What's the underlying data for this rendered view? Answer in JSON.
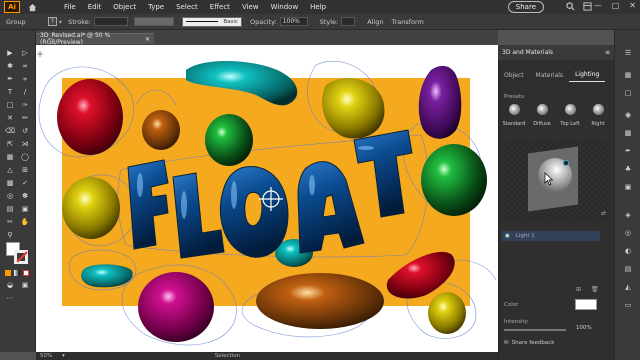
{
  "menubar": {
    "app_logo": "Ai",
    "items": [
      "File",
      "Edit",
      "Object",
      "Type",
      "Select",
      "Effect",
      "View",
      "Window",
      "Help"
    ],
    "share_label": "Share"
  },
  "controlbar": {
    "selection_label": "Group",
    "stroke_label": "Stroke:",
    "brush_label": "Basic",
    "opacity_label": "Opacity:",
    "opacity_value": "100%",
    "style_label": "Style:",
    "align_label": "Align",
    "transform_label": "Transform"
  },
  "document": {
    "tab_title": "3D_Revised.ai* @ 50 % (RGB/Preview)",
    "artwork_text": "FLOAT",
    "background_color": "#f5a91e"
  },
  "statusbar": {
    "zoom": "50%",
    "tool_name": "Selection"
  },
  "panel": {
    "title": "3D and Materials",
    "tabs": [
      "Object",
      "Materials",
      "Lighting"
    ],
    "active_tab": "Lighting",
    "presets_label": "Presets",
    "presets": [
      "Standard",
      "Diffuse",
      "Top Left",
      "Right"
    ],
    "light_name": "Light 1",
    "color_label": "Color",
    "intensity_label": "Intensity",
    "intensity_value": "100%",
    "feedback_label": "Share feedback"
  },
  "icons": [
    "home-icon",
    "search-icon",
    "arrange-icon",
    "eye-icon",
    "add-light-icon",
    "delete-light-icon",
    "cursor-icon"
  ]
}
